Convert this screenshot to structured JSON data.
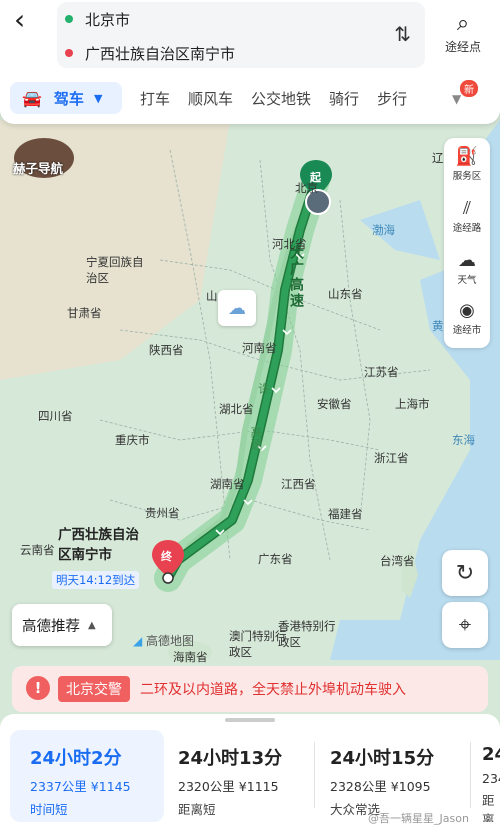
{
  "header": {
    "origin": "北京市",
    "destination": "广西壮族自治区南宁市",
    "waypoint_label": "途经点"
  },
  "modes": {
    "active": "驾车",
    "items": [
      "打车",
      "顺风车",
      "公交地铁",
      "骑行",
      "步行"
    ],
    "new_badge": "新"
  },
  "watermark": {
    "text": "赫子导航"
  },
  "map": {
    "labels": {
      "beijing": "北京",
      "hebei": "河北省",
      "bohai": "渤海",
      "ningxia": "宁夏回族自\n治区",
      "gansu": "甘肃省",
      "shanxi": "山",
      "shandong": "山东省",
      "shaanxi": "陕西省",
      "henan": "河南省",
      "jiangsu": "江苏省",
      "hubei": "湖北省",
      "anhui": "安徽省",
      "shanghai": "上海市",
      "sichuan": "四川省",
      "chongqing": "重庆市",
      "donghai": "东海",
      "zhejiang": "浙江省",
      "hunan": "湖南省",
      "jiangxi": "江西省",
      "guizhou": "贵州省",
      "fujian": "福建省",
      "guangxi": "广西壮族自治\n区南宁市",
      "yunnan": "云南省",
      "guangdong": "广东省",
      "taiwan": "台湾省",
      "macau": "澳门特别行\n政区",
      "hongkong": "香港特别行\n政区",
      "hainan": "海南省",
      "huang": "黄",
      "liao": "辽"
    },
    "highway_names": {
      "daguang": "大广高速",
      "xu": "许",
      "gao2": "高速"
    },
    "start_label": "起",
    "end_label": "终",
    "eta": "明天14:12到达",
    "map_logo": "高德地图",
    "route_color": "#2ea05a"
  },
  "side_panel": {
    "items": [
      {
        "icon": "service-area-icon",
        "label": "服务区"
      },
      {
        "icon": "route-icon",
        "label": "途经路"
      },
      {
        "icon": "weather-icon",
        "label": "天气"
      },
      {
        "icon": "city-icon",
        "label": "途经市"
      }
    ]
  },
  "preference": {
    "label": "高德推荐"
  },
  "alert": {
    "tag": "北京交警",
    "text": "二环及以内道路，全天禁止外埠机动车驶入"
  },
  "routes": [
    {
      "time": "24小时2分",
      "distance": "2337公里 ¥1145",
      "tag": "时间短"
    },
    {
      "time": "24小时13分",
      "distance": "2320公里 ¥1115",
      "tag": "距离短"
    },
    {
      "time": "24小时15分",
      "distance": "2328公里 ¥1095",
      "tag": "大众常选"
    },
    {
      "time": "24",
      "distance": "234",
      "tag": "距离"
    }
  ],
  "footer_watermark": "@吾一辆星星_Jason",
  "colors": {
    "accent": "#1a6cf2",
    "alert": "#e03030",
    "route": "#2ea05a"
  }
}
